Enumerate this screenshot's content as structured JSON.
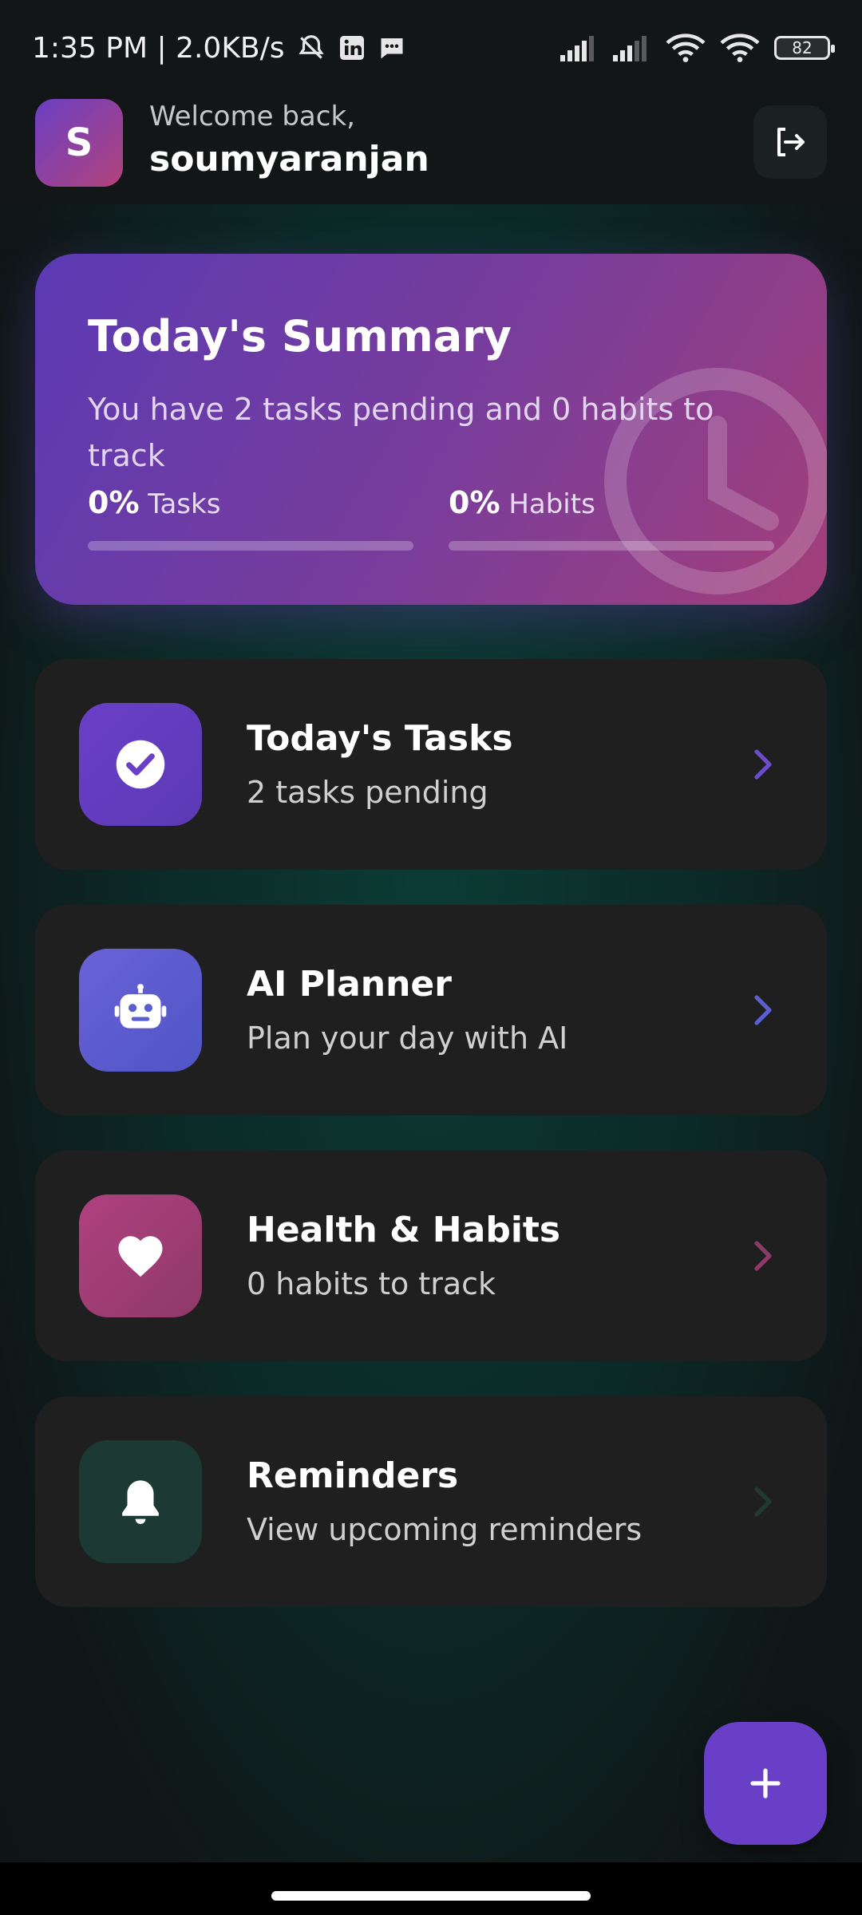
{
  "status_bar": {
    "time_speed": "1:35 PM | 2.0KB/s",
    "battery": "82"
  },
  "header": {
    "avatar_letter": "S",
    "welcome": "Welcome back,",
    "username": "soumyaranjan"
  },
  "summary": {
    "title": "Today's Summary",
    "text": "You have 2 tasks pending and 0 habits to track",
    "tasks_percent": "0%",
    "tasks_label": "Tasks",
    "habits_percent": "0%",
    "habits_label": "Habits",
    "tasks_progress": 0,
    "habits_progress": 0
  },
  "cards": [
    {
      "title": "Today's Tasks",
      "subtitle": "2 tasks pending",
      "icon": "check-circle-icon",
      "color": "#6a3fc8",
      "chevron_color": "#6a4ccc"
    },
    {
      "title": "AI Planner",
      "subtitle": "Plan your day with AI",
      "icon": "robot-icon",
      "color": "#5a5fd0",
      "chevron_color": "#5b5fd0"
    },
    {
      "title": "Health & Habits",
      "subtitle": "0 habits to track",
      "icon": "heart-icon",
      "color": "#a23d72",
      "chevron_color": "#8e3a68"
    },
    {
      "title": "Reminders",
      "subtitle": "View upcoming reminders",
      "icon": "bell-icon",
      "color": "#1c3a33",
      "chevron_color": "#1f3a33"
    }
  ],
  "colors": {
    "accent": "#6a3fc8",
    "summary_gradient_start": "#5b3ab4",
    "summary_gradient_end": "#a33f79",
    "card_bg": "#1f1f1f"
  }
}
